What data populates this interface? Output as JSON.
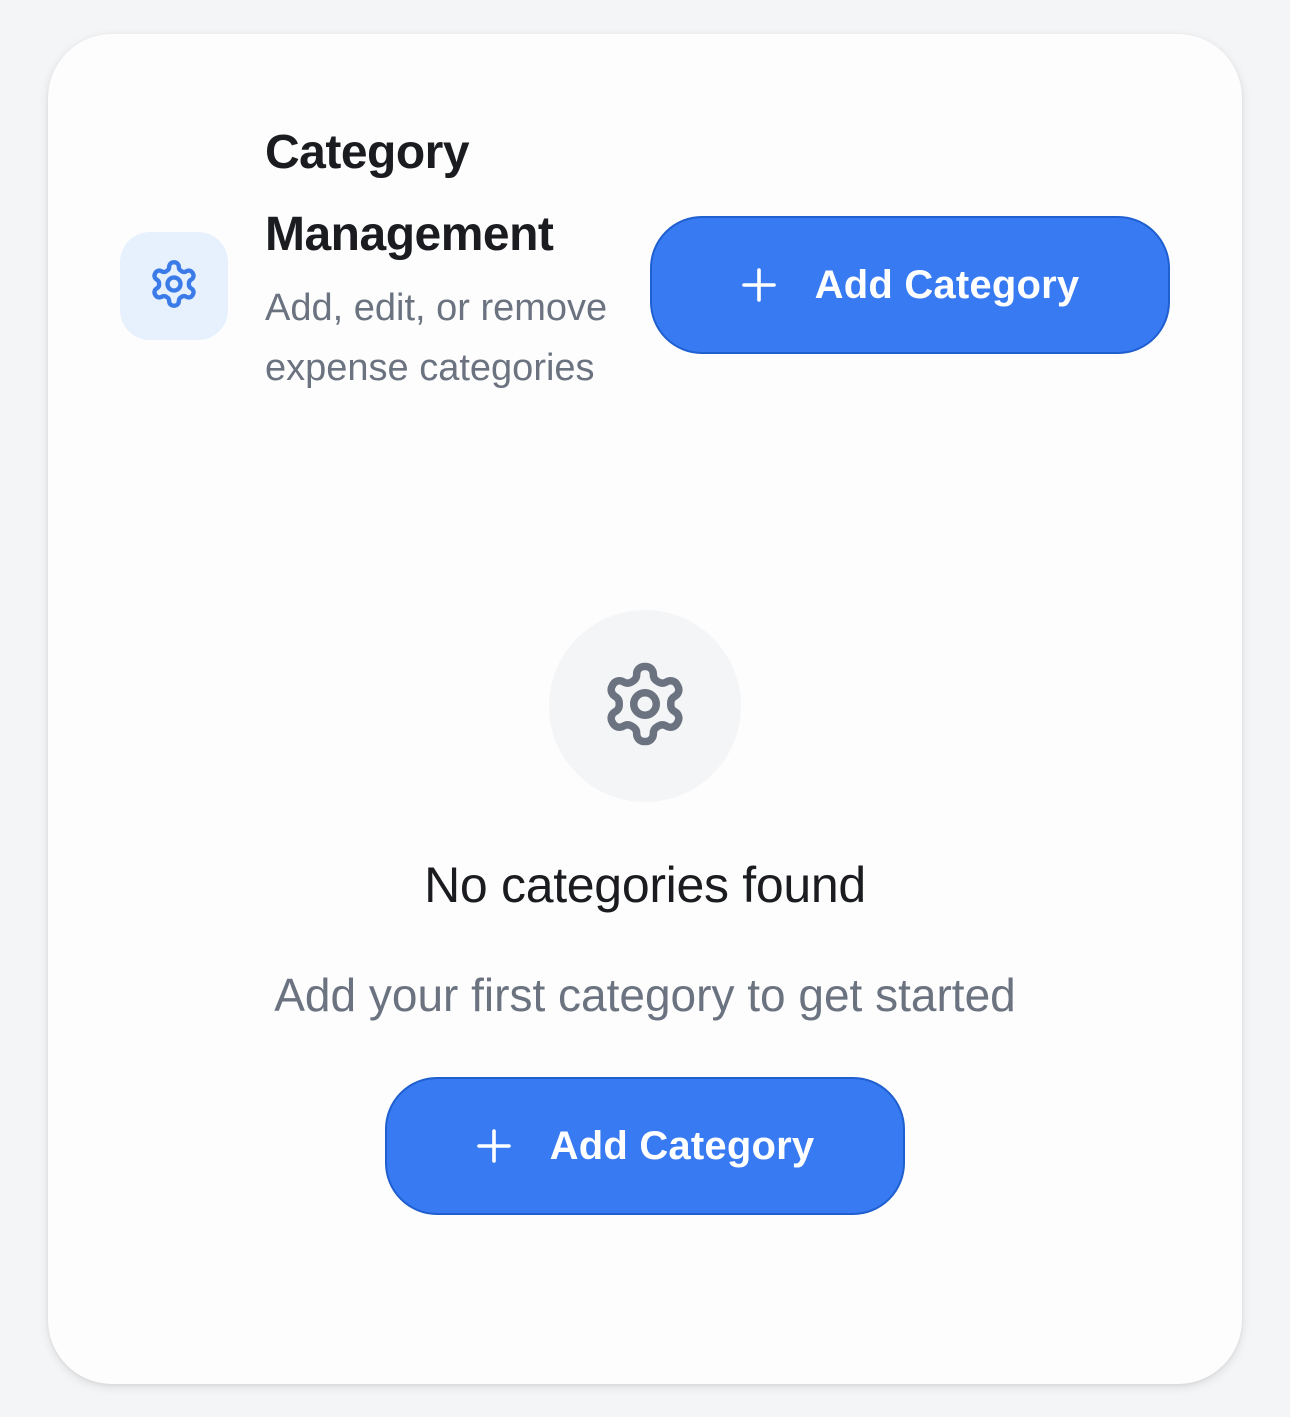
{
  "header": {
    "icon": "gear-icon",
    "title": "Category Management",
    "description": "Add, edit, or remove expense categories",
    "add_button": {
      "icon": "plus-icon",
      "label": "Add Category"
    }
  },
  "empty_state": {
    "icon": "gear-icon",
    "title": "No categories found",
    "description": "Add your first category to get started",
    "add_button": {
      "icon": "plus-icon",
      "label": "Add Category"
    }
  },
  "colors": {
    "accent": "#377af2",
    "accent_border": "#1f5fcf",
    "icon_blue": "#3b7be8",
    "icon_bg_blue": "#e7f0fd",
    "icon_gray": "#6b7280",
    "text_primary": "#1a1c20",
    "text_secondary": "#6b7280"
  }
}
